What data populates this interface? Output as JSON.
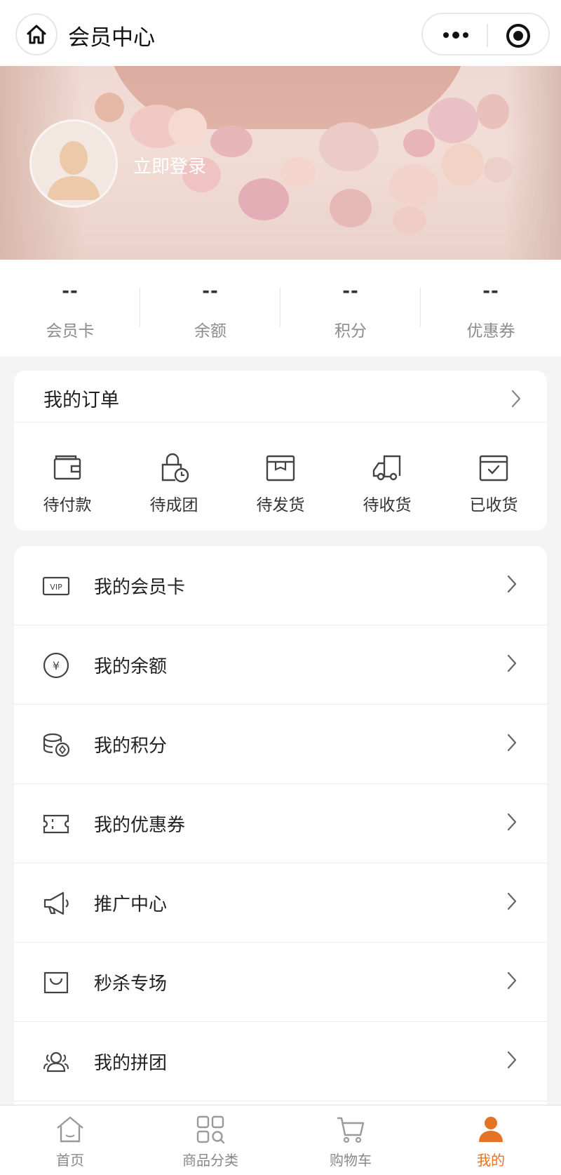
{
  "header": {
    "title": "会员中心"
  },
  "banner": {
    "login_text": "立即登录"
  },
  "stats": [
    {
      "value": "--",
      "label": "会员卡"
    },
    {
      "value": "--",
      "label": "余额"
    },
    {
      "value": "--",
      "label": "积分"
    },
    {
      "value": "--",
      "label": "优惠券"
    }
  ],
  "orders": {
    "title": "我的订单",
    "items": [
      {
        "label": "待付款",
        "icon": "wallet-icon"
      },
      {
        "label": "待成团",
        "icon": "lock-clock-icon"
      },
      {
        "label": "待发货",
        "icon": "box-icon"
      },
      {
        "label": "待收货",
        "icon": "truck-icon"
      },
      {
        "label": "已收货",
        "icon": "box-check-icon"
      }
    ]
  },
  "menu": [
    {
      "label": "我的会员卡",
      "icon": "vip-icon"
    },
    {
      "label": "我的余额",
      "icon": "yen-icon"
    },
    {
      "label": "我的积分",
      "icon": "coins-icon"
    },
    {
      "label": "我的优惠券",
      "icon": "ticket-icon"
    },
    {
      "label": "推广中心",
      "icon": "megaphone-icon"
    },
    {
      "label": "秒杀专场",
      "icon": "bag-icon"
    },
    {
      "label": "我的拼团",
      "icon": "group-icon"
    }
  ],
  "tabbar": [
    {
      "label": "首页",
      "icon": "home-icon",
      "active": false
    },
    {
      "label": "商品分类",
      "icon": "category-icon",
      "active": false
    },
    {
      "label": "购物车",
      "icon": "cart-icon",
      "active": false
    },
    {
      "label": "我的",
      "icon": "user-icon",
      "active": true
    }
  ],
  "colors": {
    "accent": "#e67223",
    "icon_gray": "#9a9a9a",
    "text_dark": "#222222"
  }
}
